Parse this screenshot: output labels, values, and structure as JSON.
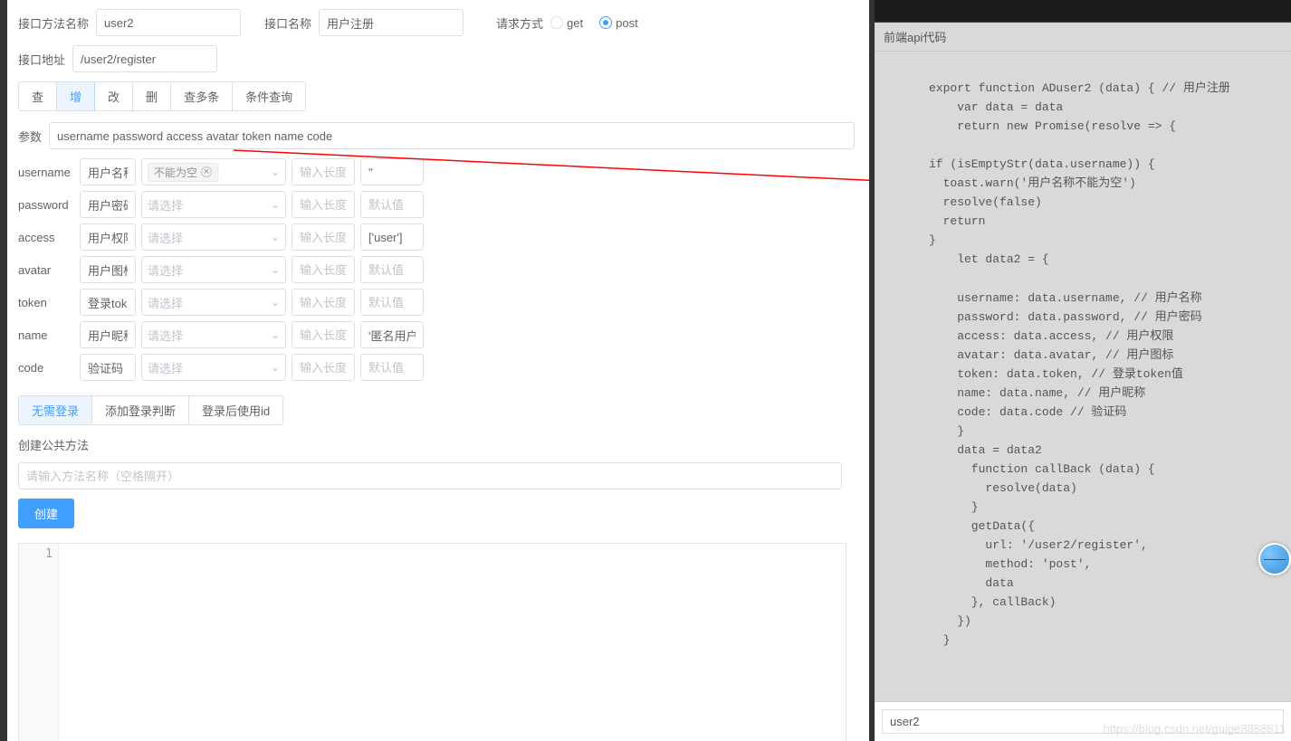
{
  "header": {
    "method_name_label": "接口方法名称",
    "method_name_value": "user2",
    "api_name_label": "接口名称",
    "api_name_value": "用户注册",
    "request_method_label": "请求方式",
    "get_label": "get",
    "post_label": "post",
    "url_label": "接口地址",
    "url_value": "/user2/register"
  },
  "crud_tabs": [
    "查",
    "增",
    "改",
    "删",
    "查多条",
    "条件查询"
  ],
  "crud_active_index": 1,
  "params": {
    "label": "参数",
    "value": "username password access avatar token name code"
  },
  "fields": [
    {
      "key": "username",
      "desc": "用户名称",
      "rule_tag": "不能为空",
      "rule_placeholder": "",
      "len_ph": "输入长度",
      "def": "''"
    },
    {
      "key": "password",
      "desc": "用户密码",
      "rule_tag": "",
      "rule_placeholder": "请选择",
      "len_ph": "输入长度",
      "def": "默认值"
    },
    {
      "key": "access",
      "desc": "用户权限",
      "rule_tag": "",
      "rule_placeholder": "请选择",
      "len_ph": "输入长度",
      "def": "['user']"
    },
    {
      "key": "avatar",
      "desc": "用户图标",
      "rule_tag": "",
      "rule_placeholder": "请选择",
      "len_ph": "输入长度",
      "def": "默认值"
    },
    {
      "key": "token",
      "desc": "登录token",
      "rule_tag": "",
      "rule_placeholder": "请选择",
      "len_ph": "输入长度",
      "def": "默认值"
    },
    {
      "key": "name",
      "desc": "用户昵称",
      "rule_tag": "",
      "rule_placeholder": "请选择",
      "len_ph": "输入长度",
      "def": "'匿名用户"
    },
    {
      "key": "code",
      "desc": "验证码",
      "rule_tag": "",
      "rule_placeholder": "请选择",
      "len_ph": "输入长度",
      "def": "默认值"
    }
  ],
  "login_tabs": [
    "无需登录",
    "添加登录判断",
    "登录后使用id"
  ],
  "login_active_index": 0,
  "public_method": {
    "label": "创建公共方法",
    "placeholder": "请输入方法名称（空格隔开）",
    "create_btn": "创建"
  },
  "editor": {
    "line1": "1"
  },
  "right": {
    "title": "前端api代码",
    "code": "export function ADuser2 (data) { // 用户注册\n    var data = data\n    return new Promise(resolve => {\n\nif (isEmptyStr(data.username)) {\n  toast.warn('用户名称不能为空')\n  resolve(false)\n  return\n}\n    let data2 = {\n\n    username: data.username, // 用户名称\n    password: data.password, // 用户密码\n    access: data.access, // 用户权限\n    avatar: data.avatar, // 用户图标\n    token: data.token, // 登录token值\n    name: data.name, // 用户昵称\n    code: data.code // 验证码\n    }\n    data = data2\n      function callBack (data) {\n        resolve(data)\n      }\n      getData({\n        url: '/user2/register',\n        method: 'post',\n        data\n      }, callBack)\n    })\n  }",
    "footer_value": "user2",
    "watermark": "https://blog.csdn.net/guige8888811"
  }
}
